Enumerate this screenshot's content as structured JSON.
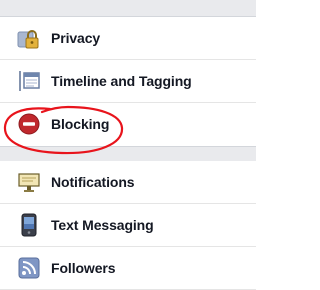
{
  "settings": {
    "items": [
      {
        "label": "Privacy",
        "icon": "lock-icon"
      },
      {
        "label": "Timeline and Tagging",
        "icon": "timeline-icon"
      },
      {
        "label": "Blocking",
        "icon": "blocking-icon"
      },
      {
        "label": "Notifications",
        "icon": "notifications-icon"
      },
      {
        "label": "Text Messaging",
        "icon": "phone-icon"
      },
      {
        "label": "Followers",
        "icon": "rss-icon"
      }
    ]
  },
  "colors": {
    "annotation": "#e8141c",
    "blocking_red": "#c0282d",
    "separator": "#e9eaed"
  }
}
